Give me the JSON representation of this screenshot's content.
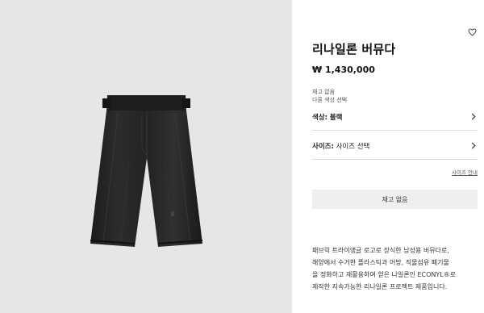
{
  "product": {
    "title": "리나일론 버뮤다",
    "price": "₩ 1,430,000",
    "image_alt": "black-nylon-bermuda-shorts"
  },
  "availability": {
    "stock_status": "재고 없음",
    "other_color_link": "다른 색상 선택"
  },
  "options": {
    "color": {
      "label": "색상:",
      "value": "블랙"
    },
    "size": {
      "label": "사이즈:",
      "value": "사이즈 선택"
    }
  },
  "size_guide_link": "사이즈 안내",
  "cta": {
    "label": "재고 없음"
  },
  "description": {
    "lines": [
      "패브릭 트라이앵글 로고로 장식한 남성용 버뮤다로,",
      "해양에서 수거한 플라스틱과 어망, 직물섬유 폐기물",
      "을 정화하고 재활용하여 얻은 나일론인 ECONYL®로",
      "제작한 지속가능한 리나일론 프로젝트 제품입니다."
    ]
  },
  "icons": {
    "wishlist": "heart-outline-icon",
    "chevron": "chevron-right-icon"
  }
}
